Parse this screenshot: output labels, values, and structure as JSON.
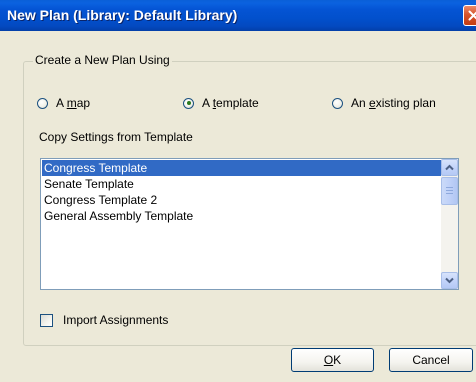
{
  "window": {
    "title": "New Plan (Library: Default Library)"
  },
  "group": {
    "label": "Create a New Plan Using"
  },
  "options": {
    "map": {
      "prefix": "A ",
      "mnemonic": "m",
      "suffix": "ap",
      "checked": false
    },
    "template": {
      "prefix": "A ",
      "mnemonic": "t",
      "suffix": "emplate",
      "checked": true
    },
    "existing": {
      "prefix": "An ",
      "mnemonic": "e",
      "suffix": "xisting plan",
      "checked": false
    }
  },
  "templates": {
    "label": "Copy Settings from Template",
    "items": [
      "Congress Template",
      "Senate Template",
      "Congress Template 2",
      "General Assembly Template"
    ],
    "selected_index": 0
  },
  "import_assignments": {
    "label": "Import Assignments",
    "checked": false
  },
  "buttons": {
    "ok": {
      "mnemonic": "O",
      "rest": "K"
    },
    "cancel": "Cancel"
  }
}
